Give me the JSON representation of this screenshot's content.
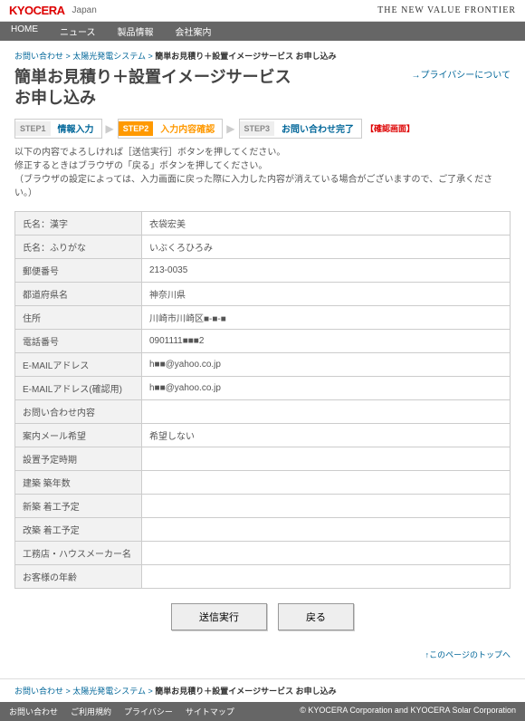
{
  "header": {
    "brand": "KYOCERA",
    "region": "Japan",
    "tagline": "THE NEW VALUE FRONTIER"
  },
  "gnav": [
    "HOME",
    "ニュース",
    "製品情報",
    "会社案内"
  ],
  "breadcrumb": {
    "a1": "お問い合わせ",
    "a2": "太陽光発電システム",
    "current": "簡単お見積り＋設置イメージサービス お申し込み"
  },
  "title": "簡単お見積り＋設置イメージサービス\nお申し込み",
  "privacy": "→プライバシーについて",
  "steps": [
    {
      "label": "STEP1",
      "text": "情報入力"
    },
    {
      "label": "STEP2",
      "text": "入力内容確認"
    },
    {
      "label": "STEP3",
      "text": "お問い合わせ完了"
    }
  ],
  "confirm": "【確認画面】",
  "note": "以下の内容でよろしければ［送信実行］ボタンを押してください。\n修正するときはブラウザの「戻る」ボタンを押してください。\n（ブラウザの設定によっては、入力画面に戻った際に入力した内容が消えている場合がございますので、ご了承ください。）",
  "rows": [
    {
      "label": "氏名：漢字",
      "value": "衣袋宏美"
    },
    {
      "label": "氏名：ふりがな",
      "value": "いぶくろひろみ"
    },
    {
      "label": "郵便番号",
      "value": "213-0035"
    },
    {
      "label": "都道府県名",
      "value": "神奈川県"
    },
    {
      "label": "住所",
      "value": "川崎市川崎区■-■-■"
    },
    {
      "label": "電話番号",
      "value": "0901111■■■2"
    },
    {
      "label": "E-MAILアドレス",
      "value": "h■■@yahoo.co.jp"
    },
    {
      "label": "E-MAILアドレス(確認用)",
      "value": "h■■@yahoo.co.jp"
    },
    {
      "label": "お問い合わせ内容",
      "value": ""
    },
    {
      "label": "案内メール希望",
      "value": "希望しない"
    },
    {
      "label": "設置予定時期",
      "value": ""
    },
    {
      "label": "建築 築年数",
      "value": ""
    },
    {
      "label": "新築 着工予定",
      "value": ""
    },
    {
      "label": "改築 着工予定",
      "value": ""
    },
    {
      "label": "工務店・ハウスメーカー名",
      "value": ""
    },
    {
      "label": "お客様の年齢",
      "value": ""
    }
  ],
  "buttons": {
    "submit": "送信実行",
    "back": "戻る"
  },
  "pagetop": "↑このページのトップへ",
  "footer_links": [
    "お問い合わせ",
    "ご利用規約",
    "プライバシー",
    "サイトマップ"
  ],
  "copyright": "© KYOCERA Corporation and KYOCERA Solar Corporation"
}
